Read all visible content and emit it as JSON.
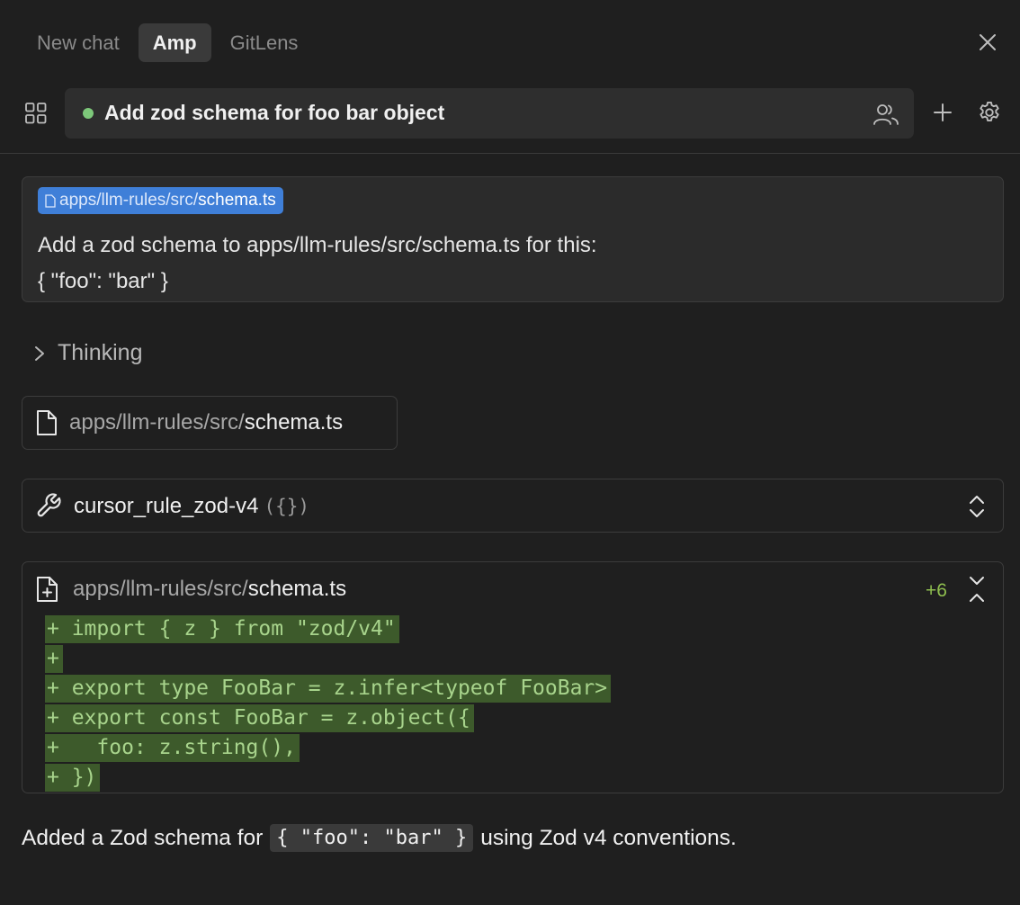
{
  "tabs": [
    {
      "label": "New chat",
      "active": false
    },
    {
      "label": "Amp",
      "active": true
    },
    {
      "label": "GitLens",
      "active": false
    }
  ],
  "thread": {
    "title": "Add zod schema for foo bar object",
    "status": "active",
    "status_color": "#7dc87a"
  },
  "user_message": {
    "chip_path_dim": "apps/llm-rules/src/",
    "chip_path_bright": "schema.ts",
    "line1": "Add a zod schema to apps/llm-rules/src/schema.ts for this:",
    "line2": "{ \"foo\": \"bar\" }"
  },
  "thinking_label": "Thinking",
  "read_file": {
    "path_dim": "apps/llm-rules/src/",
    "path_bright": "schema.ts"
  },
  "tool_call": {
    "name": "cursor_rule_zod-v4",
    "args": "({})"
  },
  "diff": {
    "path_dim": "apps/llm-rules/src/",
    "path_bright": "schema.ts",
    "added_count": "+6",
    "lines": [
      "+ import { z } from \"zod/v4\"",
      "+",
      "+ export type FooBar = z.infer<typeof FooBar>",
      "+ export const FooBar = z.object({",
      "+   foo: z.string(),",
      "+ })"
    ]
  },
  "summary": {
    "prefix": "Added a Zod schema for",
    "code": "{ \"foo\": \"bar\" }",
    "suffix": "using Zod v4 conventions."
  },
  "icons": [
    "close-icon",
    "grid-icon",
    "people-icon",
    "plus-icon",
    "gear-icon",
    "file-icon",
    "chevron-right-icon",
    "wrench-icon",
    "expand-icon",
    "file-plus-icon",
    "collapse-icon"
  ],
  "colors": {
    "accent": "#3f7fd8",
    "added": "#8fbf4f",
    "diff_bg": "#3d5a2b"
  }
}
